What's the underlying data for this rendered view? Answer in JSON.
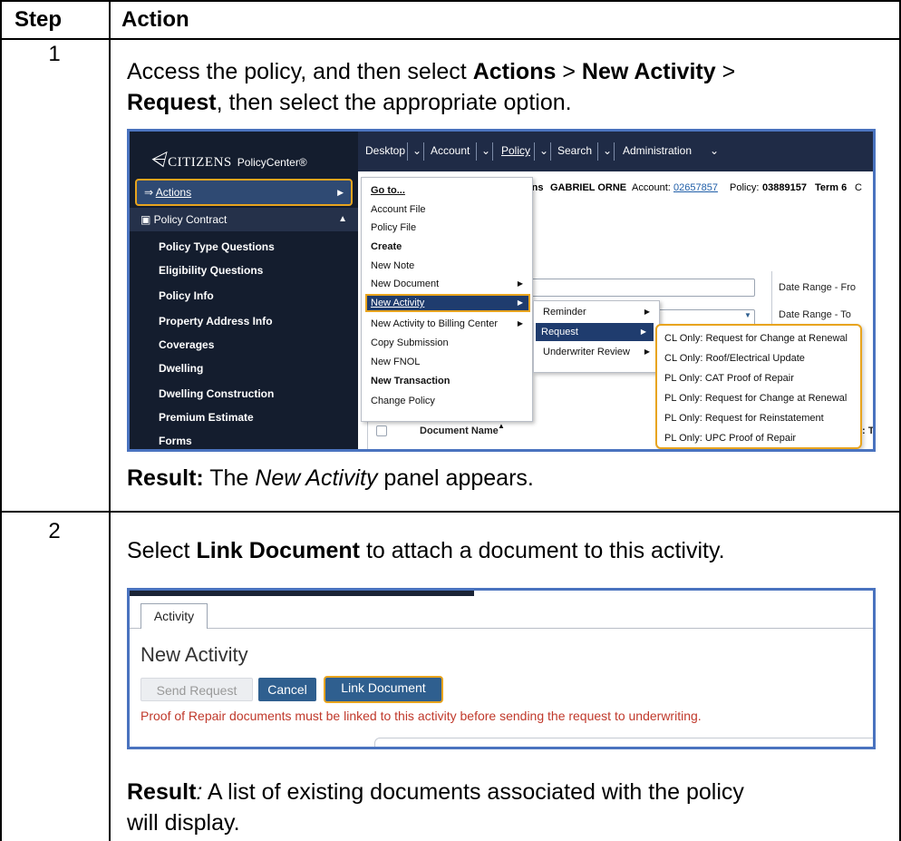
{
  "table": {
    "col_step": "Step",
    "col_action": "Action"
  },
  "steps": [
    {
      "number": "1",
      "instruction_parts": [
        "Access the policy, and then select ",
        "Actions",
        " > ",
        "New Activity",
        " >",
        "Request",
        ", then select the appropriate option."
      ],
      "result_label": "Result:",
      "result_text_a": " The ",
      "result_italic": "New Activity",
      "result_text_b": " panel appears."
    },
    {
      "number": "2",
      "instruction_a": "Select ",
      "instruction_bold": "Link Document",
      "instruction_b": " to attach a document to this activity.",
      "result_label": "Result",
      "result_colon": ":",
      "result_line1": " A list of existing documents associated with the policy",
      "result_line2": "will display."
    }
  ],
  "screenshot1": {
    "brand": "CITIZENS",
    "product": "PolicyCenter®",
    "top_menu": [
      "Desktop",
      "Account",
      "Policy",
      "Search",
      "Administration"
    ],
    "policy_line": {
      "name_frag": "zens",
      "insured": "GABRIEL ORNE",
      "account_label": "Account:",
      "account_no": "02657857",
      "policy_label": "Policy:",
      "policy_no": "03889157",
      "term": "Term 6",
      "trail": "C"
    },
    "sidebar": {
      "actions": "Actions",
      "policy_contract": "Policy Contract",
      "items": [
        "Policy Type Questions",
        "Eligibility Questions",
        "Policy Info",
        "Property Address Info",
        "Coverages",
        "Dwelling",
        "Dwelling Construction",
        "Premium Estimate",
        "Forms"
      ]
    },
    "actions_menu": [
      "Go to...",
      "Account File",
      "Policy File",
      "Create",
      "New Note",
      "New Document",
      "New Activity",
      "New Activity to Billing Center",
      "Copy Submission",
      "New FNOL",
      "New Transaction",
      "Change Policy"
    ],
    "activity_submenu": [
      "Reminder",
      "Request",
      "Underwriter Review"
    ],
    "request_submenu": [
      "CL Only: Request for Change at Renewal",
      "CL Only: Roof/Electrical Update",
      "PL Only: CAT Proof of Repair",
      "PL Only: Request for Change at Renewal",
      "PL Only: Request for Reinstatement",
      "PL Only: UPC Proof of Repair"
    ],
    "labels": {
      "date_from": "Date Range - Fro",
      "date_to": "Date Range - To",
      "doc_name": "Document Name",
      "frag_ed": "ed",
      "frag_t": ": T"
    }
  },
  "screenshot2": {
    "tab": "Activity",
    "title": "New Activity",
    "buttons": [
      "Send Request",
      "Cancel",
      "Link Document"
    ],
    "warning": "Proof of Repair documents must be linked to this activity before sending the request to underwriting."
  },
  "colors": {
    "highlight": "#e8a41e",
    "nav_dark": "#141d2e",
    "screenshot_border": "#4a73bf",
    "warning_red": "#c0392b"
  }
}
